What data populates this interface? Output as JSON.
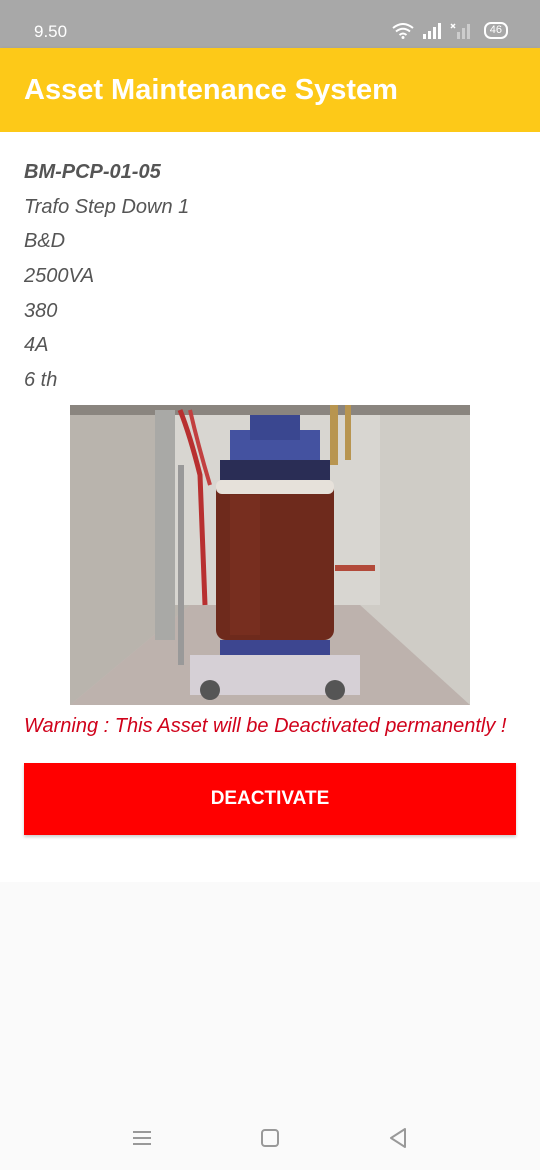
{
  "status_bar": {
    "time": "9.50",
    "battery": "46"
  },
  "app_bar": {
    "title": "Asset Maintenance System"
  },
  "asset": {
    "code": "BM-PCP-01-05",
    "name": "Trafo Step Down 1",
    "brand": "B&D",
    "power": "2500VA",
    "voltage": "380",
    "current": "4A",
    "age": "6 th"
  },
  "warning": "Warning : This Asset will be Deactivated permanently !",
  "deactivate_label": "DEACTIVATE",
  "colors": {
    "app_bar": "#fdc918",
    "button": "#ff0000",
    "warning": "#d0021b",
    "status_bar": "#a8a8a8"
  },
  "nav_icons": [
    "menu-icon",
    "home-icon",
    "back-icon"
  ]
}
